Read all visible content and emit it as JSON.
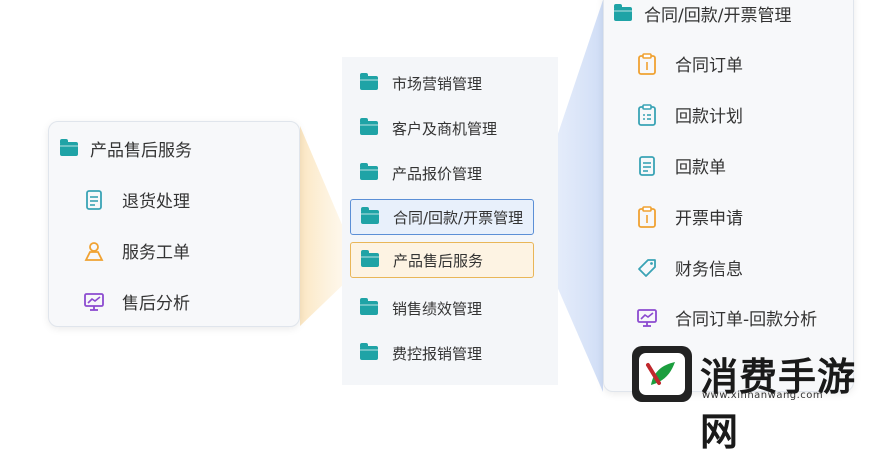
{
  "left_card": {
    "title": "产品售后服务",
    "items": [
      {
        "label": "退货处理",
        "icon": "document-icon"
      },
      {
        "label": "服务工单",
        "icon": "person-icon"
      },
      {
        "label": "售后分析",
        "icon": "monitor-chart-icon"
      }
    ]
  },
  "middle_menu": {
    "items": [
      {
        "label": "市场营销管理"
      },
      {
        "label": "客户及商机管理"
      },
      {
        "label": "产品报价管理"
      },
      {
        "label": "合同/回款/开票管理",
        "state": "selected-blue"
      },
      {
        "label": "产品售后服务",
        "state": "selected-orange"
      },
      {
        "label": "销售绩效管理"
      },
      {
        "label": "费控报销管理"
      }
    ]
  },
  "right_card": {
    "title": "合同/回款/开票管理",
    "items": [
      {
        "label": "合同订单",
        "icon": "clipboard-icon"
      },
      {
        "label": "回款计划",
        "icon": "clipboard-list-icon"
      },
      {
        "label": "回款单",
        "icon": "document-icon"
      },
      {
        "label": "开票申请",
        "icon": "clipboard-icon"
      },
      {
        "label": "财务信息",
        "icon": "tag-icon"
      },
      {
        "label": "合同订单-回款分析",
        "icon": "monitor-chart-icon"
      }
    ]
  },
  "watermark": {
    "title": "消费手游网",
    "url": "www.xinnanwang.com"
  },
  "colors": {
    "folder": "#1fa3a6",
    "accent_blue": "#5b8fd6",
    "accent_orange": "#e9b658",
    "icon_teal": "#3aa3b5",
    "icon_orange": "#f0a232",
    "icon_purple": "#8c4bd0"
  }
}
